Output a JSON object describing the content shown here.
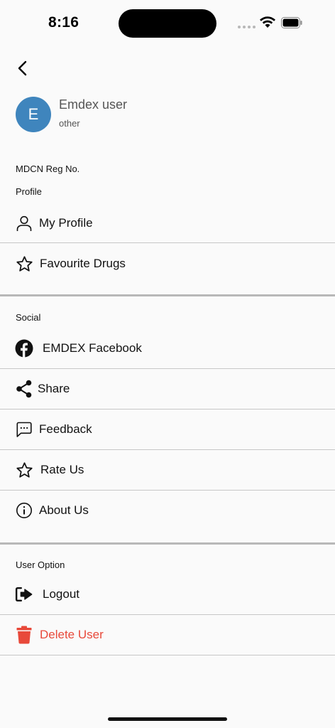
{
  "status_bar": {
    "time": "8:16"
  },
  "user": {
    "initial": "E",
    "name": "Emdex user",
    "role": "other",
    "avatar_color": "#3f85bd"
  },
  "reg_label": "MDCN Reg No.",
  "sections": {
    "profile": {
      "title": "Profile",
      "items": [
        {
          "label": "My Profile",
          "icon": "person-icon"
        },
        {
          "label": "Favourite Drugs",
          "icon": "star-icon"
        }
      ]
    },
    "social": {
      "title": "Social",
      "items": [
        {
          "label": "EMDEX Facebook",
          "icon": "facebook-icon"
        },
        {
          "label": "Share",
          "icon": "share-icon"
        },
        {
          "label": "Feedback",
          "icon": "feedback-icon"
        },
        {
          "label": "Rate Us",
          "icon": "star-icon"
        },
        {
          "label": "About Us",
          "icon": "info-icon"
        }
      ]
    },
    "user_option": {
      "title": "User Option",
      "items": [
        {
          "label": "Logout",
          "icon": "logout-icon"
        },
        {
          "label": "Delete User",
          "icon": "trash-icon",
          "color": "#e8493a"
        }
      ]
    }
  }
}
